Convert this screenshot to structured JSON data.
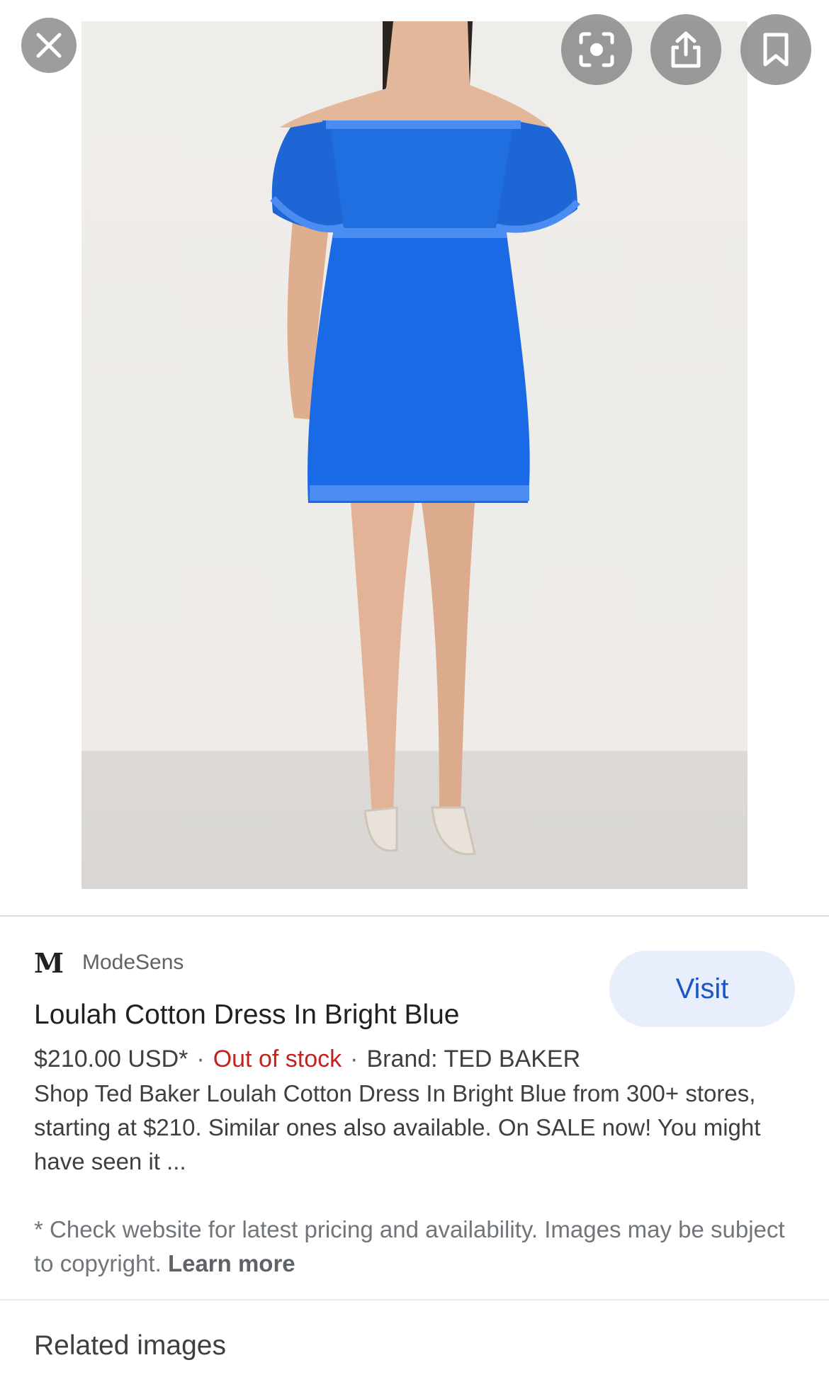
{
  "viewer": {
    "close_icon": "close-icon",
    "lens_icon": "lens-icon",
    "share_icon": "share-icon",
    "save_icon": "bookmark-icon",
    "photo_subject": "woman wearing bright blue off-shoulder dress",
    "dress_color": "#1f6fe0"
  },
  "result": {
    "source_logo": "M",
    "source_name": "ModeSens",
    "visit_label": "Visit",
    "title": "Loulah Cotton Dress In Bright Blue",
    "price": "$210.00 USD*",
    "separator": "·",
    "stock_status": "Out of stock",
    "brand": "Brand: TED BAKER",
    "description": "Shop Ted Baker Loulah Cotton Dress In Bright Blue from 300+ stores, starting at $210. Similar ones also available. On SALE now! You might have seen it ...",
    "note": "* Check website for latest pricing and availability. Images may be subject to copyright.",
    "learn_more": "Learn more"
  },
  "related": {
    "heading": "Related images"
  },
  "colors": {
    "accent": "#1a56c4",
    "visit_bg": "#e8eefc",
    "out_of_stock": "#c5221f"
  }
}
